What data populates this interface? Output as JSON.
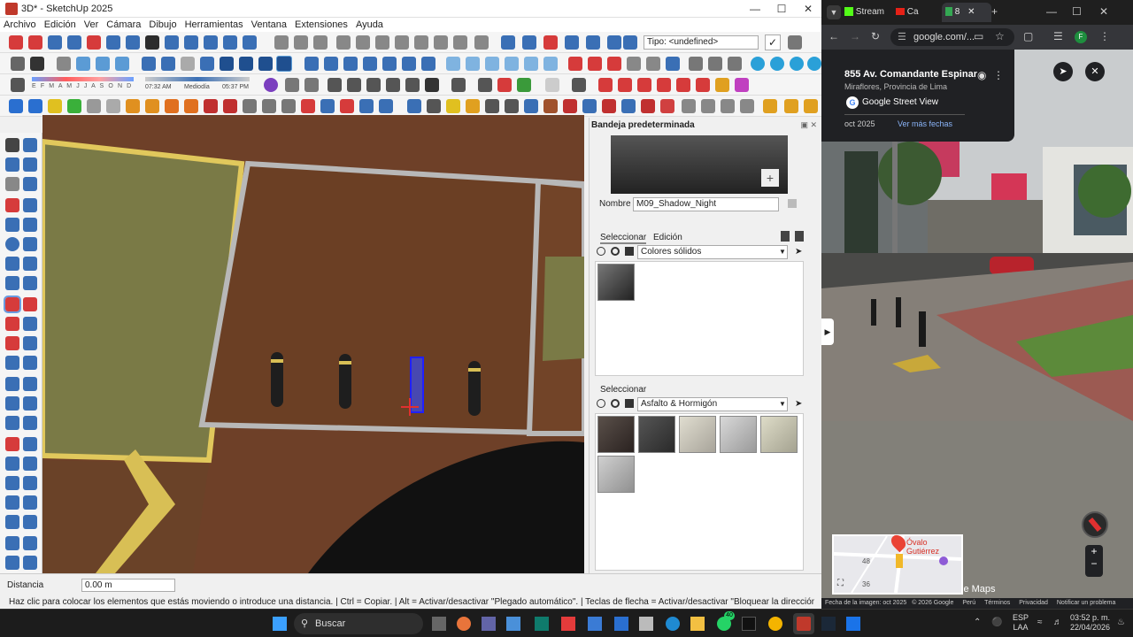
{
  "sketchup": {
    "title": "3D* - SketchUp 2025",
    "menu": [
      "Archivo",
      "Edición",
      "Ver",
      "Cámara",
      "Dibujo",
      "Herramientas",
      "Ventana",
      "Extensiones",
      "Ayuda"
    ],
    "type_field": "Tipo: <undefined>",
    "shadow_months": "E F M A M J J A S O N D",
    "shadow_time_left": "07:32 AM",
    "shadow_mid": "Mediodía",
    "shadow_time_right": "05:37 PM",
    "tray_title": "Bandeja predeterminada",
    "name_label": "Nombre",
    "name_value": "M09_Shadow_Night",
    "tab_select": "Seleccionar",
    "tab_edit": "Edición",
    "library1": "Colores sólidos",
    "select_label2": "Seleccionar",
    "library2": "Asfalto & Hormigón",
    "measure_label": "Distancia",
    "measure_value": "0.00 m",
    "status_text": "Haz clic para colocar los elementos que estás moviendo o introduce una distancia. | Ctrl = Copiar. | Alt = Activar/desactivar \"Plegado automático\". | Teclas de flecha = Activar/desactivar \"Bloquear la dirección de la inferenci..."
  },
  "chrome": {
    "tabs": [
      "Stream",
      "Ca",
      "8"
    ],
    "address": "google.com/...",
    "place_title": "855 Av. Comandante Espinar",
    "place_sub": "Miraflores, Provincia de Lima",
    "streetview_label": "Google Street View",
    "date": "oct 2025",
    "more_dates": "Ver más fechas",
    "minimap_place": "Óvalo Gutiérrez",
    "minimap_num1": "48",
    "minimap_num2": "36",
    "maps_label": "le Maps",
    "footer": [
      "Fecha de la imagen: oct 2025",
      "© 2026 Google",
      "Perú",
      "Términos",
      "Privacidad",
      "Notificar un problema"
    ]
  },
  "taskbar": {
    "search": "Buscar",
    "lang1": "ESP",
    "lang2": "LAA",
    "time": "03:52 p. m.",
    "date": "22/04/2026",
    "badge": "40"
  }
}
